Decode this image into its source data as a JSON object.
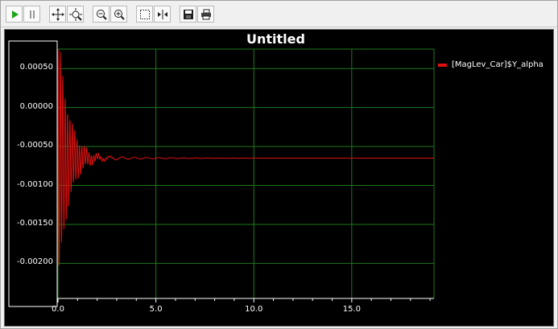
{
  "toolbar": {
    "buttons": [
      {
        "name": "play-icon"
      },
      {
        "name": "pause-icon"
      },
      {
        "name": "pan-icon"
      },
      {
        "name": "zoom-fit-icon"
      },
      {
        "name": "zoom-out-icon"
      },
      {
        "name": "zoom-in-icon"
      },
      {
        "name": "select-region-icon"
      },
      {
        "name": "fit-horizontal-icon"
      },
      {
        "name": "save-icon"
      },
      {
        "name": "print-icon"
      }
    ]
  },
  "colors": {
    "background": "#000000",
    "grid": "#1d7a1d",
    "series": "#e01010",
    "y_axis_box": "#ffffff"
  },
  "chart_data": {
    "type": "line",
    "title": "Untitled",
    "xlabel": "",
    "ylabel": "",
    "xlim": [
      0,
      19.2
    ],
    "ylim": [
      -0.00245,
      0.00075
    ],
    "x_ticks": [
      "0.0",
      "5.0",
      "10.0",
      "15.0"
    ],
    "y_ticks": [
      "0.00050",
      "0.00000",
      "-0.00050",
      "-0.00100",
      "-0.00150",
      "-0.00200"
    ],
    "grid": true,
    "legend_position": "top-right",
    "series": [
      {
        "name": "[MagLev_Car]$Y_alpha",
        "model": {
          "kind": "damped_oscillation",
          "steady_state": -0.00065,
          "initial_amplitude": 0.00165,
          "decay_rate": 1.9,
          "tail_amplitude": 7e-05,
          "tail_decay": 0.45,
          "frequency_hz": 8.2,
          "tail_frequency_hz": 1.6,
          "x_end": 19.2
        }
      }
    ]
  }
}
